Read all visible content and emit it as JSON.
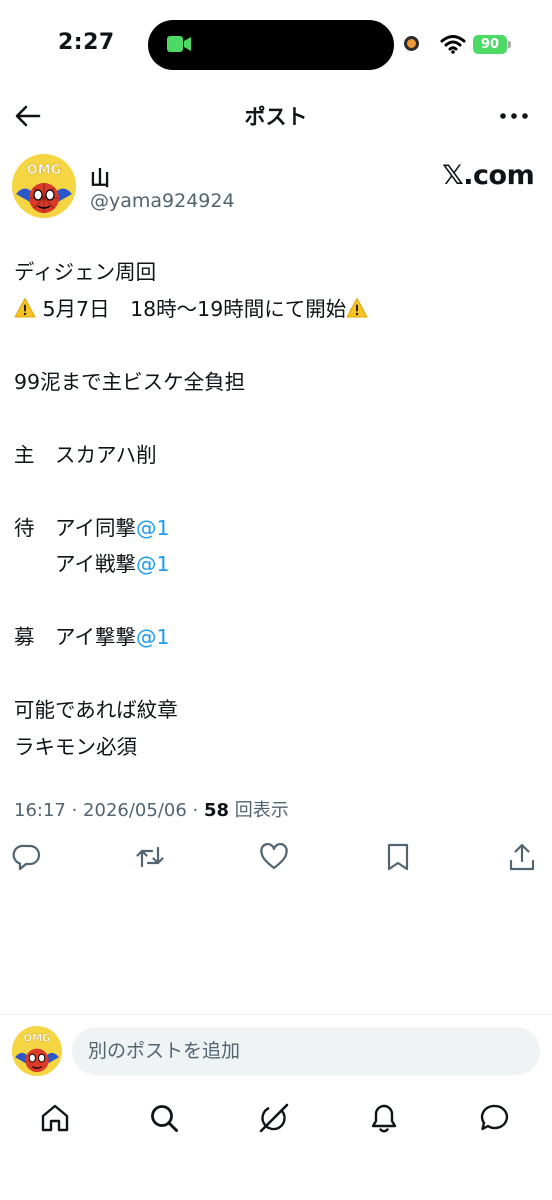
{
  "status_bar": {
    "time": "2:27",
    "battery": "90",
    "icons": [
      "facetime-video-icon",
      "recording-dot-icon",
      "wifi-icon",
      "battery-icon"
    ]
  },
  "header": {
    "title": "ポスト",
    "back_icon": "back-arrow-icon",
    "more_icon": "more-dots-icon"
  },
  "author": {
    "name": "山",
    "handle": "@yama924924",
    "avatar_label": "OMG",
    "platform_logo": "𝕏.com"
  },
  "tweet": {
    "lines": [
      {
        "text": "ディジェン周回"
      },
      {
        "warn_before": true,
        "text": " 5月7日　18時〜19時間にて開始",
        "warn_after": true
      },
      {
        "text": ""
      },
      {
        "text": "99泥まで主ビスケ全負担"
      },
      {
        "text": ""
      },
      {
        "text": "主　スカアハ削"
      },
      {
        "text": ""
      },
      {
        "text": "待　アイ同撃",
        "mention": "@1"
      },
      {
        "text": "　　アイ戦撃",
        "mention": "@1"
      },
      {
        "text": ""
      },
      {
        "text": "募　アイ撃撃",
        "mention": "@1"
      },
      {
        "text": ""
      },
      {
        "text": "可能であれば紋章"
      },
      {
        "text": "ラキモン必須"
      }
    ]
  },
  "meta": {
    "time": "16:17",
    "date": "2026/05/06",
    "views_count": "58",
    "views_label": "回表示"
  },
  "actions": [
    "reply-icon",
    "repost-icon",
    "like-icon",
    "bookmark-icon",
    "share-icon"
  ],
  "reply_box": {
    "placeholder": "別のポストを追加",
    "avatar_label": "OMG"
  },
  "bottom_nav": [
    "home-icon",
    "search-icon",
    "grok-icon",
    "notifications-icon",
    "messages-icon"
  ],
  "colors": {
    "text": "#0f1419",
    "secondary": "#536471",
    "mention": "#1d9bf0",
    "avatar_bg": "#f5d642",
    "battery": "#4cd964"
  }
}
